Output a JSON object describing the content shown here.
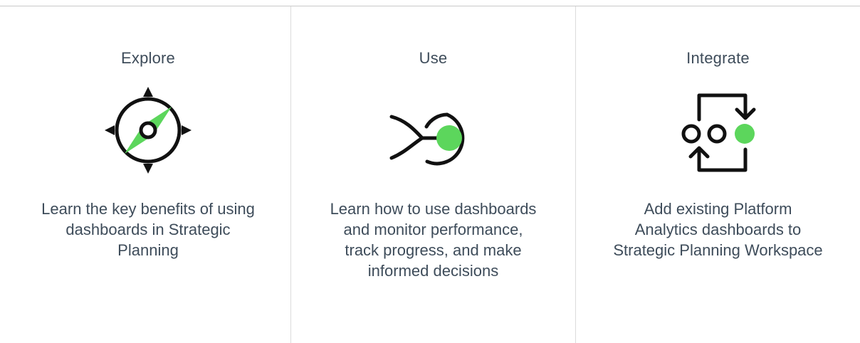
{
  "cards": [
    {
      "title": "Explore",
      "icon": "compass-icon",
      "description": "Learn the key benefits of using dashboards in Strategic Planning"
    },
    {
      "title": "Use",
      "icon": "merge-target-icon",
      "description": "Learn how to use dashboards and monitor performance, track progress, and make informed decisions"
    },
    {
      "title": "Integrate",
      "icon": "cycle-arrows-icon",
      "description": "Add existing Platform Analytics dashboards to Strategic Planning Workspace"
    }
  ],
  "colors": {
    "accent": "#5cd65c",
    "icon_stroke": "#111111",
    "text": "#3e4c5a",
    "divider": "#dcdcdc"
  }
}
